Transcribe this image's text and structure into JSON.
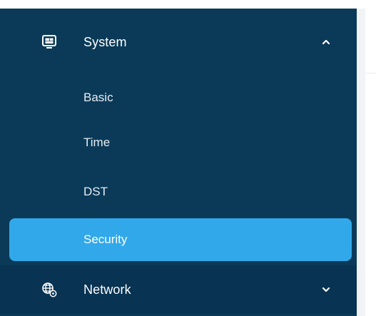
{
  "sidebar": {
    "groups": [
      {
        "label": "System",
        "icon": "monitor-icon",
        "expanded": true,
        "chevron": "chevron-up-icon",
        "items": [
          {
            "label": "Basic",
            "active": false
          },
          {
            "label": "Time",
            "active": false
          },
          {
            "label": "DST",
            "active": false
          },
          {
            "label": "Security",
            "active": true
          }
        ]
      },
      {
        "label": "Network",
        "icon": "globe-gear-icon",
        "expanded": false,
        "chevron": "chevron-down-icon",
        "items": []
      }
    ]
  },
  "colors": {
    "sidebar_background": "#0b3a58",
    "active_item_background": "#31a8ea",
    "text": "#ffffff"
  }
}
